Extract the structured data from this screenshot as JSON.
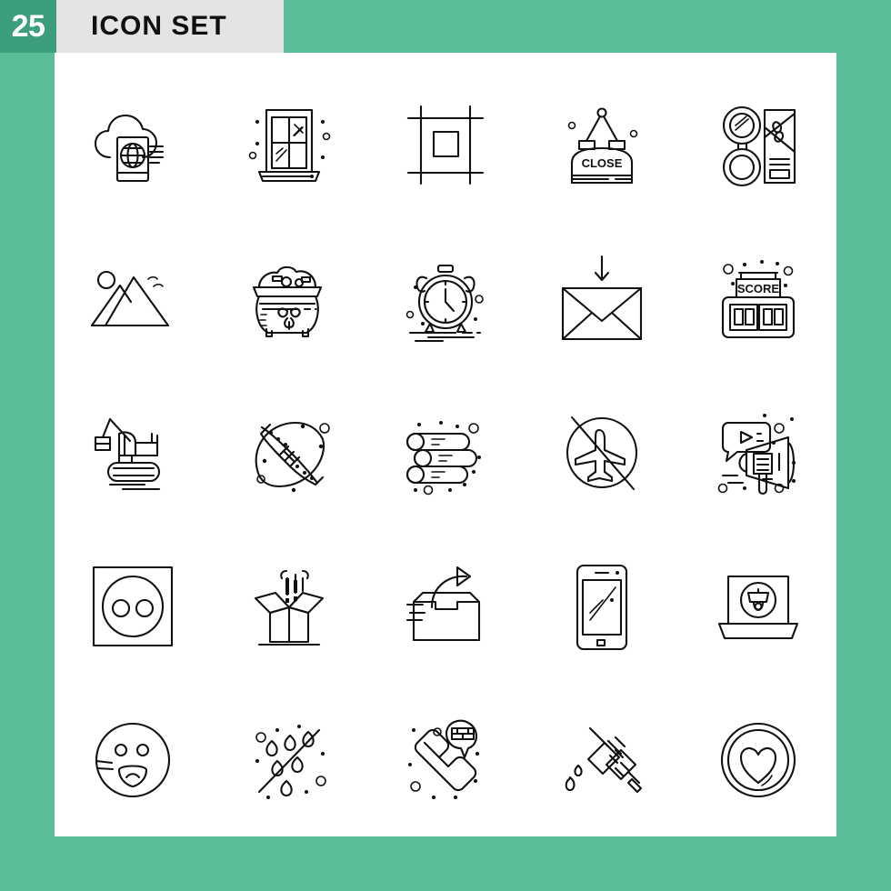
{
  "header": {
    "count": "25",
    "title": "ICON SET"
  },
  "colors": {
    "background": "#5bbd97",
    "badge": "#3d9e7c",
    "header_strip": "#e4e4e4",
    "panel": "#ffffff",
    "icon_stroke": "#111111"
  },
  "icon_labels": {
    "close_sign": "CLOSE",
    "scoreboard": "SCORE"
  },
  "icons": [
    {
      "row": 1,
      "col": 1,
      "name": "cloud-passport-globe",
      "label": "Cloud Passport"
    },
    {
      "row": 1,
      "col": 2,
      "name": "window",
      "label": "Window"
    },
    {
      "row": 1,
      "col": 3,
      "name": "crop-resize",
      "label": "Crop"
    },
    {
      "row": 1,
      "col": 4,
      "name": "close-sign",
      "label": "Close Sign"
    },
    {
      "row": 1,
      "col": 5,
      "name": "gift-ribbon",
      "label": "Gift Ribbon"
    },
    {
      "row": 2,
      "col": 1,
      "name": "mountains-landscape",
      "label": "Mountains"
    },
    {
      "row": 2,
      "col": 2,
      "name": "pot-of-gold",
      "label": "Pot Of Gold"
    },
    {
      "row": 2,
      "col": 3,
      "name": "alarm-clock",
      "label": "Alarm Clock"
    },
    {
      "row": 2,
      "col": 4,
      "name": "inbox-envelope",
      "label": "Receive Mail"
    },
    {
      "row": 2,
      "col": 5,
      "name": "scoreboard",
      "label": "Scoreboard"
    },
    {
      "row": 3,
      "col": 1,
      "name": "excavator",
      "label": "Excavator"
    },
    {
      "row": 3,
      "col": 2,
      "name": "american-football",
      "label": "Football"
    },
    {
      "row": 3,
      "col": 3,
      "name": "wood-logs",
      "label": "Logs"
    },
    {
      "row": 3,
      "col": 4,
      "name": "no-flights",
      "label": "No Flights"
    },
    {
      "row": 3,
      "col": 5,
      "name": "megaphone-video",
      "label": "Video Marketing"
    },
    {
      "row": 4,
      "col": 1,
      "name": "power-socket",
      "label": "Socket"
    },
    {
      "row": 4,
      "col": 2,
      "name": "open-box-surprise",
      "label": "Open Box"
    },
    {
      "row": 4,
      "col": 3,
      "name": "outbox-tray",
      "label": "Outbox"
    },
    {
      "row": 4,
      "col": 4,
      "name": "smartphone",
      "label": "Smartphone"
    },
    {
      "row": 4,
      "col": 5,
      "name": "laptop-security-camera",
      "label": "Monitoring"
    },
    {
      "row": 5,
      "col": 1,
      "name": "shocked-emoji",
      "label": "Shocked"
    },
    {
      "row": 5,
      "col": 2,
      "name": "water-drops",
      "label": "Water Drops"
    },
    {
      "row": 5,
      "col": 3,
      "name": "taxi-call",
      "label": "Taxi Call"
    },
    {
      "row": 5,
      "col": 4,
      "name": "syringe",
      "label": "Syringe"
    },
    {
      "row": 5,
      "col": 5,
      "name": "heart-coin",
      "label": "Heart Coin"
    }
  ]
}
